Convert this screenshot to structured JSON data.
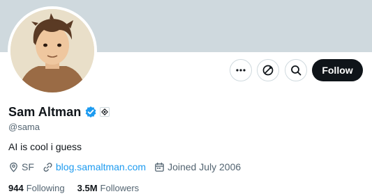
{
  "profile": {
    "display_name": "Sam Altman",
    "handle": "@sama",
    "bio": "AI is cool i guess",
    "location": "SF",
    "website": "blog.samaltman.com",
    "joined": "Joined July 2006",
    "following_count": "944",
    "following_label": "Following",
    "followers_count": "3.5M",
    "followers_label": "Followers"
  },
  "actions": {
    "follow_label": "Follow",
    "more_icon": "more-horizontal-icon",
    "subscribe_icon": "subscribe-icon",
    "search_icon": "search-icon"
  },
  "colors": {
    "banner": "#cfd9de",
    "verified_blue": "#1d9bf0",
    "follow_button_bg": "#0f1419",
    "secondary_text": "#536471"
  }
}
